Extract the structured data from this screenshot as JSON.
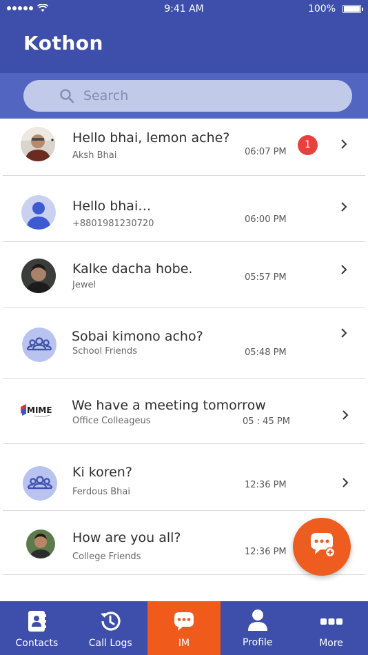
{
  "status_bar": {
    "time": "9:41 AM",
    "battery": "100%"
  },
  "header": {
    "title": "Kothon"
  },
  "search": {
    "placeholder": "Search"
  },
  "chats": [
    {
      "title": "Hello bhai, lemon ache?",
      "subtitle": "Aksh Bhai",
      "time": "06:07 PM",
      "unread": "1",
      "avatar": "photo"
    },
    {
      "title": "Hello bhai…",
      "subtitle": "+8801981230720",
      "time": "06:00 PM",
      "avatar": "person-icon"
    },
    {
      "title": "Kalke dacha hobe.",
      "subtitle": "Jewel",
      "time": "05:57 PM",
      "avatar": "photo"
    },
    {
      "title": "Sobai kimono acho?",
      "subtitle": "School Friends",
      "time": "05:48 PM",
      "avatar": "group-icon"
    },
    {
      "title": "We have a meeting tomorrow",
      "subtitle": "Office Colleageus",
      "time": "05 : 45 PM",
      "avatar": "mime-logo"
    },
    {
      "title": "Ki koren?",
      "subtitle": "Ferdous Bhai",
      "time": "12:36 PM",
      "avatar": "group-icon"
    },
    {
      "title": "How are you all?",
      "subtitle": "College Friends",
      "time": "12:36 PM",
      "avatar": "photo"
    }
  ],
  "mime_logo_text": "MIME",
  "fab": {
    "icon": "new-chat-icon"
  },
  "tabs": [
    {
      "label": "Contacts",
      "icon": "contacts-icon"
    },
    {
      "label": "Call Logs",
      "icon": "call-logs-icon"
    },
    {
      "label": "IM",
      "icon": "chat-icon",
      "active": true
    },
    {
      "label": "Profile",
      "icon": "profile-icon"
    },
    {
      "label": "More",
      "icon": "more-icon"
    }
  ],
  "colors": {
    "primary": "#3d4faa",
    "search_band": "#5265c0",
    "accent": "#f05a1a",
    "badge": "#e8413d"
  }
}
